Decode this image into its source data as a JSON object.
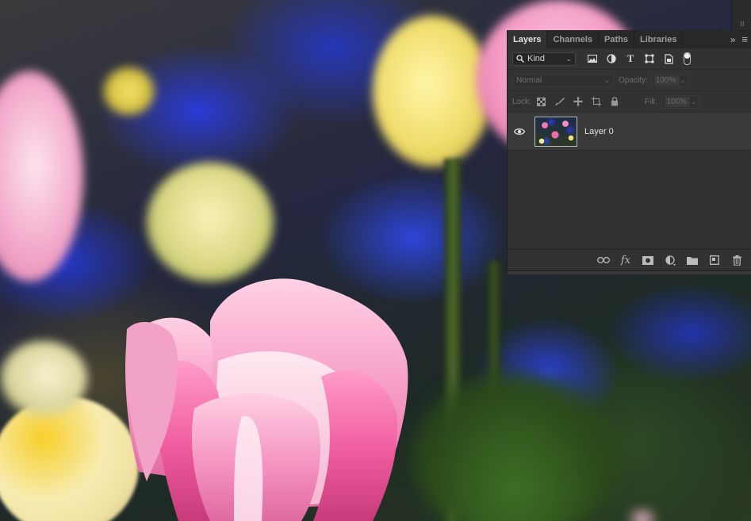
{
  "panel": {
    "tabs": [
      "Layers",
      "Channels",
      "Paths",
      "Libraries"
    ],
    "filter": {
      "kind_label": "Kind",
      "icons": [
        "pixel-filter-icon",
        "adjustment-filter-icon",
        "type-filter-icon",
        "shape-filter-icon",
        "smartobject-filter-icon",
        "filter-toggle"
      ]
    },
    "blend_mode": "Normal",
    "opacity_label": "Opacity:",
    "opacity_value": "100%",
    "lock_label": "Lock:",
    "fill_label": "Fill:",
    "fill_value": "100%",
    "layers": [
      {
        "name": "Layer 0",
        "visible": true
      }
    ],
    "footer_icons": [
      "link-layers-icon",
      "fx-icon",
      "add-mask-icon",
      "adjustment-layer-icon",
      "new-group-icon",
      "new-layer-icon",
      "trash-icon"
    ]
  },
  "canvas": {
    "subject": "pink and yellow tulips with blue flowers"
  },
  "colors": {
    "panel_bg": "#323232",
    "tab_bar_bg": "#282828",
    "layer_row_bg": "#3a3a3a",
    "tulip_pink": "#f07aae",
    "tulip_yellow": "#f2e48a",
    "flower_blue": "#2a3bd6"
  }
}
